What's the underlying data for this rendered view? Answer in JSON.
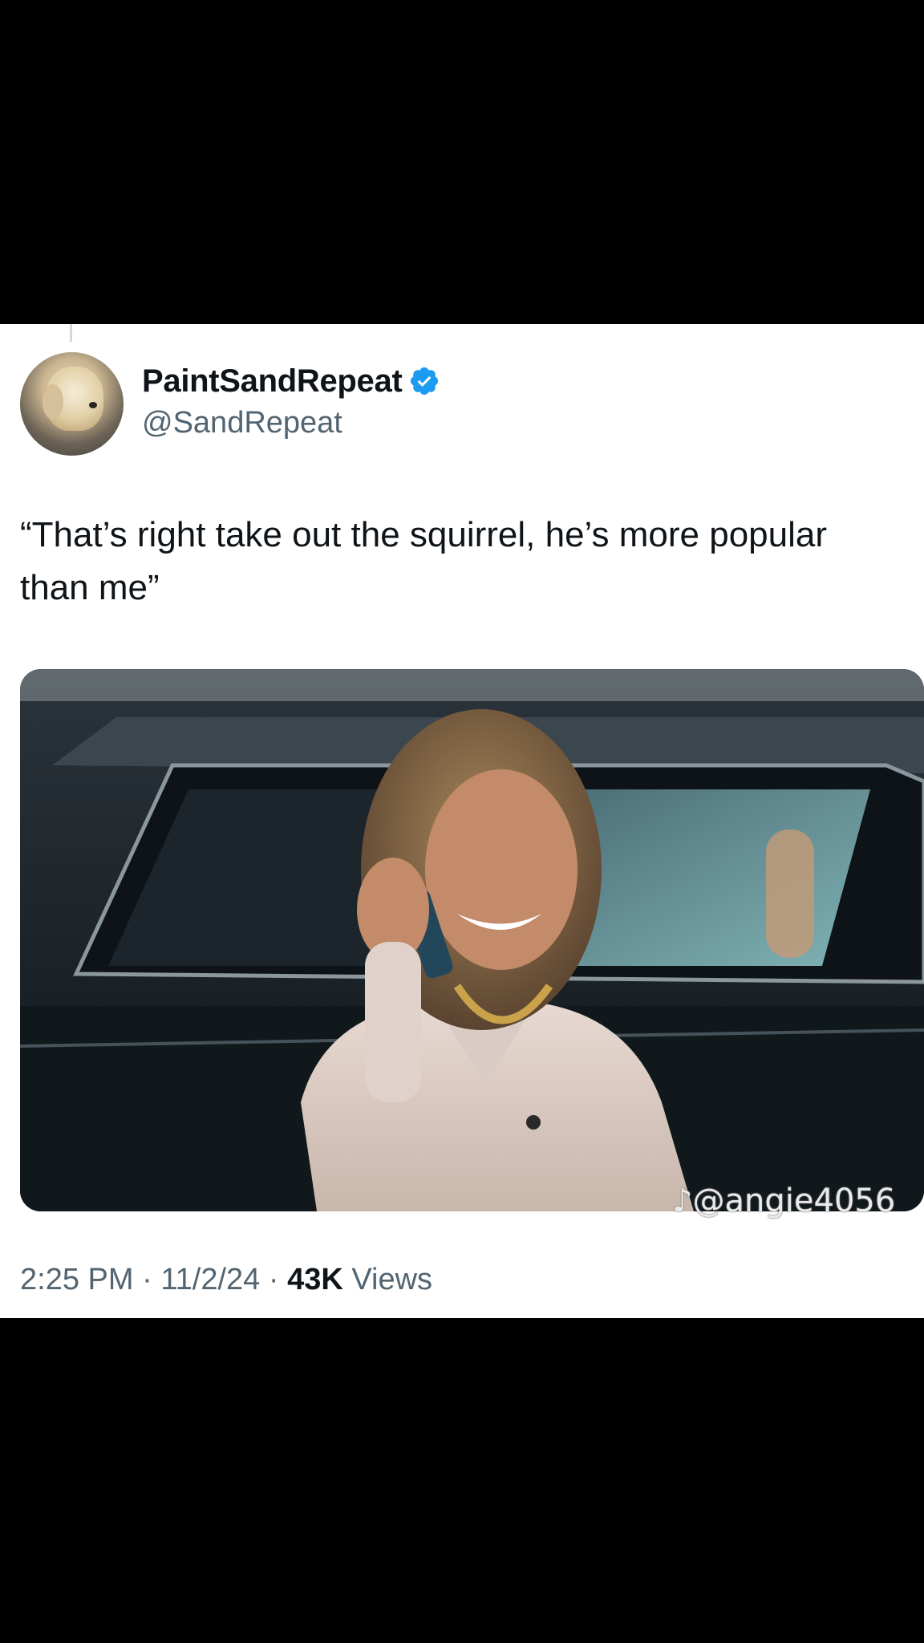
{
  "tweet": {
    "display_name": "PaintSandRepeat",
    "handle": "@SandRepeat",
    "text": "“That’s right take out the squirrel, he’s more popular than me”",
    "time": "2:25 PM",
    "date": "11/2/24",
    "separator": "·",
    "views_count": "43K",
    "views_label": "Views",
    "media_watermark": "♪@angie4056"
  },
  "icons": {
    "verified": "verified-badge-icon",
    "avatar": "dog-avatar-image"
  },
  "colors": {
    "verified_blue": "#1d9bf0",
    "text_primary": "#0f1419",
    "text_secondary": "#536471",
    "background": "#ffffff",
    "frame": "#000000"
  }
}
